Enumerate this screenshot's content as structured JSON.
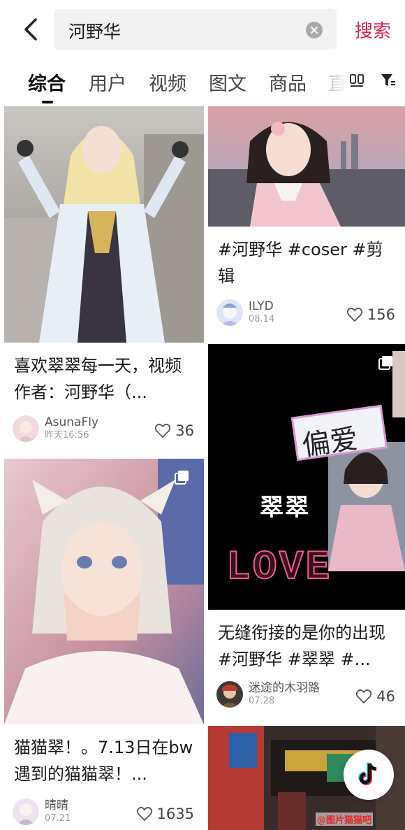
{
  "search": {
    "query": "河野华",
    "submit_label": "搜索"
  },
  "tabs": [
    {
      "label": "综合",
      "active": true
    },
    {
      "label": "用户",
      "active": false
    },
    {
      "label": "视频",
      "active": false
    },
    {
      "label": "图文",
      "active": false
    },
    {
      "label": "商品",
      "active": false
    },
    {
      "label": "直",
      "active": false
    }
  ],
  "feed": {
    "left": [
      {
        "title": "喜欢翠翠每一天，视频作者：河野华（...",
        "author": "AsunaFly",
        "date": "昨天16:56",
        "likes": "36"
      },
      {
        "title": "猫猫翠！。7.13日在bw遇到的猫猫翠！...",
        "author": "晴晴",
        "date": "07.21",
        "likes": "1635"
      }
    ],
    "right": [
      {
        "title": "#河野华 #coser #剪辑",
        "author": "ILYD",
        "date": "08.14",
        "likes": "156"
      },
      {
        "title": "无缝衔接的是你的出现#河野华 #翠翠 #...",
        "author": "迷途的木羽路",
        "date": "07.28",
        "likes": "46",
        "overlay_texts": [
          "偏爱",
          "翠翠",
          "LOVE"
        ]
      }
    ]
  },
  "watermark": "@图片猫猫吧",
  "icons": {
    "back": "back-arrow-icon",
    "clear": "clear-circle-icon",
    "layout": "layout-toggle-icon",
    "filter": "filter-icon",
    "heart": "heart-icon",
    "multi": "multi-image-icon",
    "tiktok": "douyin-logo-icon"
  },
  "colors": {
    "accent": "#e3234d",
    "search_bg": "#f2f2f3",
    "divider": "#f0f0f0"
  }
}
